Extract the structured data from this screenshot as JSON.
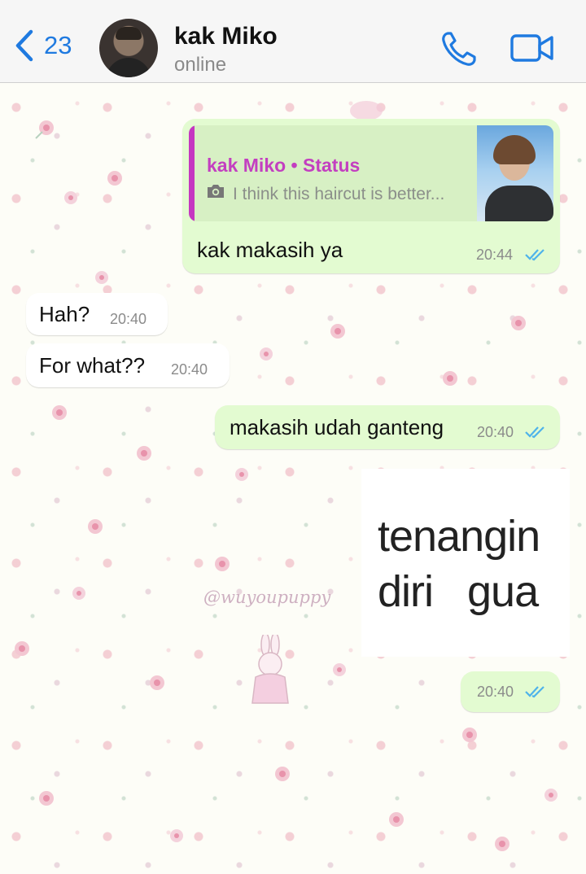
{
  "header": {
    "back_count": "23",
    "contact_name": "kak Miko",
    "contact_status": "online",
    "icons": [
      "chevron-left-icon",
      "phone-icon",
      "video-camera-icon"
    ],
    "accent_color": "#1f7ae0"
  },
  "wallpaper": {
    "watermark": "@wuyoupuppy"
  },
  "messages": [
    {
      "direction": "outgoing",
      "quote": {
        "title": "kak Miko • Status",
        "icon": "camera-icon",
        "text": "I think this haircut is better..."
      },
      "text": "kak makasih ya",
      "time": "20:44",
      "status": "read"
    },
    {
      "direction": "incoming",
      "text": "Hah?",
      "time": "20:40"
    },
    {
      "direction": "incoming",
      "text": "For what??",
      "time": "20:40"
    },
    {
      "direction": "outgoing",
      "text": "makasih udah ganteng",
      "time": "20:40",
      "status": "read"
    },
    {
      "direction": "outgoing",
      "sticker_lines": [
        "tenangin",
        "diri   gua"
      ],
      "time": "20:40",
      "status": "read"
    }
  ],
  "colors": {
    "outgoing_bubble": "#e3fbd1",
    "incoming_bubble": "#ffffff",
    "quote_accent": "#c537c1",
    "read_ticks": "#4fb3ea"
  }
}
